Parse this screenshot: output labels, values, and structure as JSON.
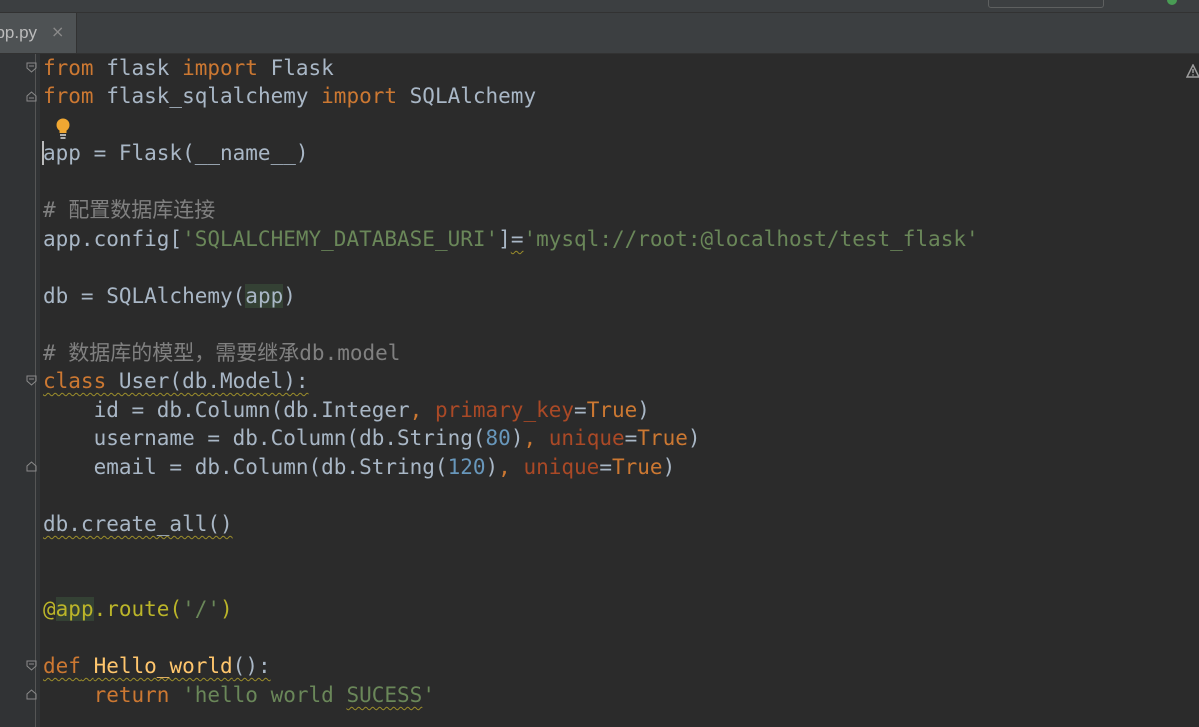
{
  "tab": {
    "filename": "app.py",
    "close_glyph": "×"
  },
  "code": {
    "l1": {
      "kw1": "from",
      "mod": " flask ",
      "kw2": "import",
      "name": " Flask"
    },
    "l2": {
      "kw1": "from",
      "mod": " flask_sqlalchemy ",
      "kw2": "import",
      "name": " SQLAlchemy"
    },
    "l4": {
      "text": "app = Flask(__name__)"
    },
    "l6": {
      "comment": "# 配置数据库连接"
    },
    "l7": {
      "a": "app.config[",
      "key": "'SQLALCHEMY_DATABASE_URI'",
      "b": "]",
      "eq": "=",
      "val": "'mysql://root:@localhost/test_flask'"
    },
    "l9": {
      "a": "db = SQLAlchemy(",
      "arg": "app",
      "b": ")"
    },
    "l11": {
      "comment": "# 数据库的模型，需要继承db.model"
    },
    "l12": {
      "kw": "class",
      "rest": " User(db.Model):"
    },
    "l13": {
      "a": "    id = db.Column(db.Integer",
      "comma": ", ",
      "param": "primary_key",
      "eq": "=",
      "val": "True",
      "b": ")"
    },
    "l14": {
      "a": "    username = db.Column(db.String(",
      "num": "80",
      "b": ")",
      "comma": ", ",
      "param": "unique",
      "eq": "=",
      "val": "True",
      "c": ")"
    },
    "l15": {
      "a": "    email = db.Column(db.String(",
      "num": "120",
      "b": ")",
      "comma": ", ",
      "param": "unique",
      "eq": "=",
      "val": "True",
      "c": ")"
    },
    "l17": {
      "text": "db.create_all()"
    },
    "l20": {
      "at": "@",
      "name": "app",
      "rest": ".route(",
      "str": "'/'",
      "close": ")"
    },
    "l22": {
      "kw": "def",
      "sp": " ",
      "fn": "Hello_world",
      "rest": "():"
    },
    "l23": {
      "indent": "    ",
      "kw": "return",
      "sp": " ",
      "str1": "'hello world ",
      "str2": "SUCESS",
      "str3": "'"
    }
  }
}
